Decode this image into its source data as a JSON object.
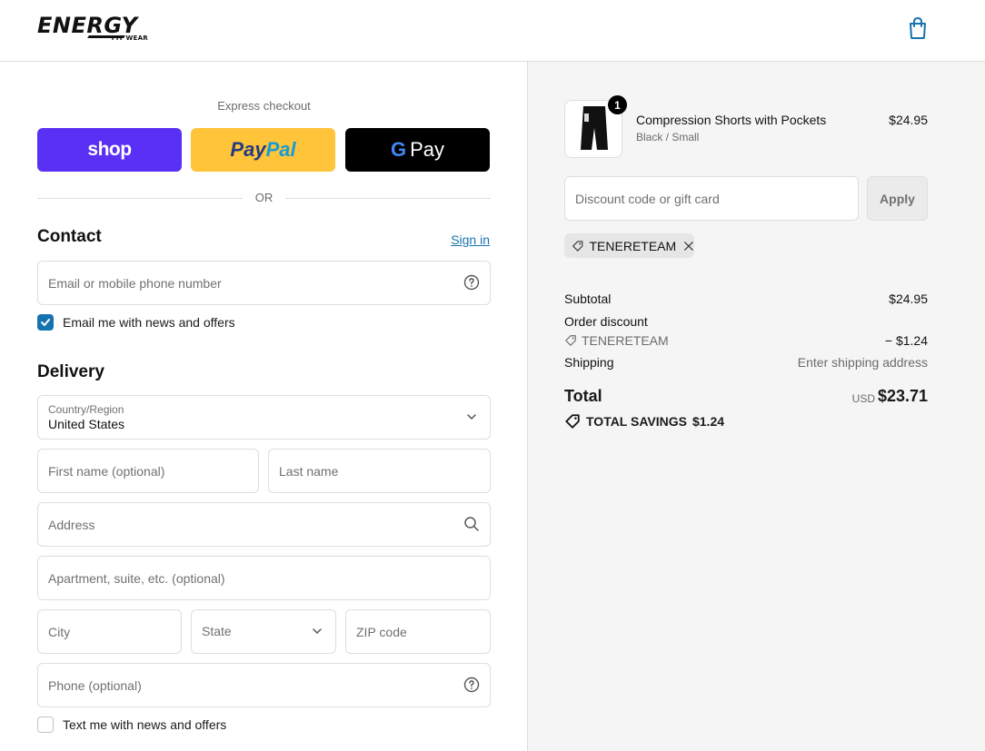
{
  "header": {
    "logo_text": "ENERGY",
    "logo_sub": "FIT WEAR",
    "cart_icon": "shopping-bag-icon"
  },
  "express": {
    "label": "Express checkout",
    "shop_label": "shop",
    "paypal_part1": "Pay",
    "paypal_part2": "Pal",
    "gpay_g": "G",
    "gpay_label": "Pay",
    "or_label": "OR"
  },
  "contact": {
    "title": "Contact",
    "sign_in": "Sign in",
    "email_placeholder": "Email or mobile phone number",
    "news_label": "Email me with news and offers",
    "news_checked": true
  },
  "delivery": {
    "title": "Delivery",
    "country_label": "Country/Region",
    "country_value": "United States",
    "first_name_placeholder": "First name (optional)",
    "last_name_placeholder": "Last name",
    "address_placeholder": "Address",
    "apartment_placeholder": "Apartment, suite, etc. (optional)",
    "city_placeholder": "City",
    "state_placeholder": "State",
    "zip_placeholder": "ZIP code",
    "phone_placeholder": "Phone (optional)",
    "sms_label": "Text me with news and offers",
    "sms_checked": false
  },
  "order": {
    "quantity_badge": "1",
    "product_name": "Compression Shorts with Pockets",
    "product_variant": "Black / Small",
    "product_price": "$24.95",
    "discount_placeholder": "Discount code or gift card",
    "apply_label": "Apply",
    "applied_code": "TENERETEAM",
    "subtotal_label": "Subtotal",
    "subtotal_value": "$24.95",
    "order_discount_label": "Order discount",
    "discount_code": "TENERETEAM",
    "discount_value": "− $1.24",
    "shipping_label": "Shipping",
    "shipping_value": "Enter shipping address",
    "total_label": "Total",
    "currency": "USD",
    "total_value": "$23.71",
    "savings_label": "TOTAL SAVINGS",
    "savings_value": "$1.24"
  },
  "colors": {
    "shop_purple": "#5a31f4",
    "paypal_yellow": "#ffc439",
    "link_blue": "#1773b0",
    "summary_bg": "#f5f5f5"
  }
}
